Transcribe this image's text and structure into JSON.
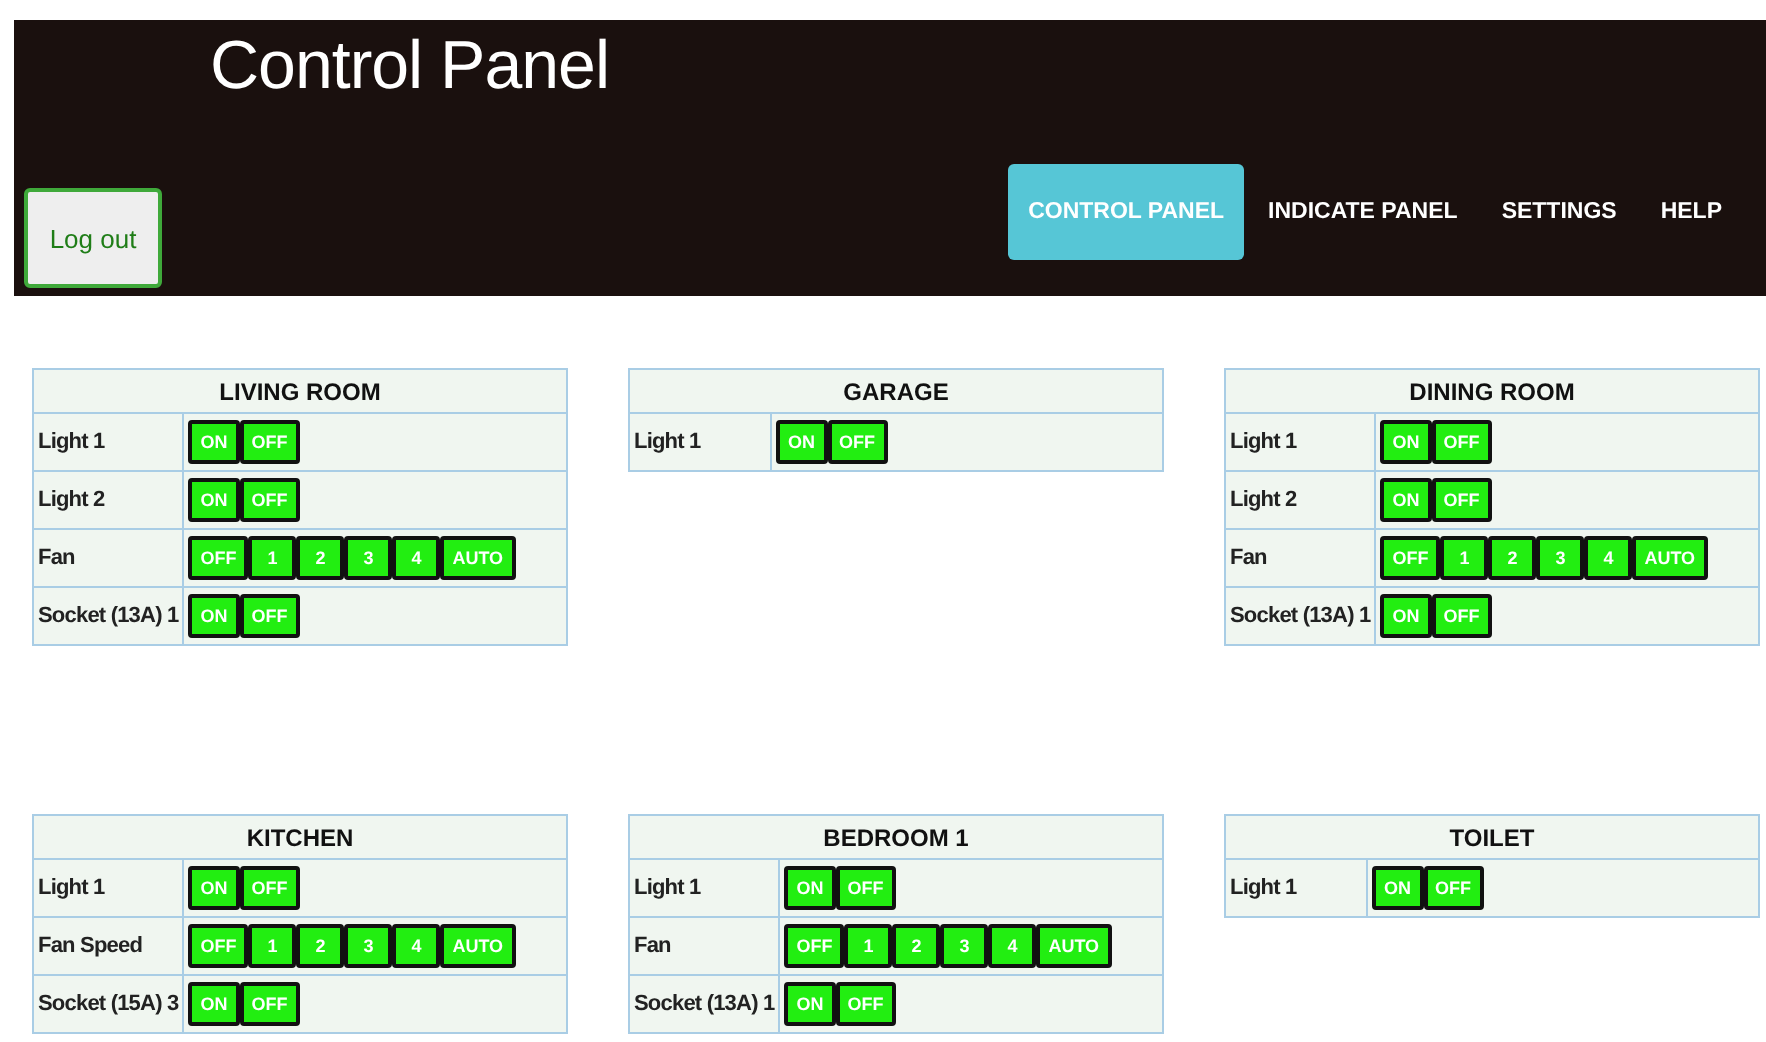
{
  "header": {
    "title": "Control Panel",
    "logout": "Log out",
    "nav": [
      {
        "label": "CONTROL PANEL",
        "selected": true
      },
      {
        "label": "INDICATE PANEL",
        "selected": false
      },
      {
        "label": "SETTINGS",
        "selected": false
      },
      {
        "label": "HELP",
        "selected": false
      }
    ]
  },
  "rooms": [
    {
      "name": "LIVING ROOM",
      "rows": [
        {
          "label": "Light 1",
          "buttons": [
            "ON",
            "OFF"
          ]
        },
        {
          "label": "Light 2",
          "buttons": [
            "ON",
            "OFF"
          ]
        },
        {
          "label": "Fan",
          "buttons": [
            "OFF",
            "1",
            "2",
            "3",
            "4",
            "AUTO"
          ]
        },
        {
          "label": "Socket (13A) 1",
          "buttons": [
            "ON",
            "OFF"
          ]
        }
      ]
    },
    {
      "name": "GARAGE",
      "rows": [
        {
          "label": "Light 1",
          "buttons": [
            "ON",
            "OFF"
          ]
        }
      ]
    },
    {
      "name": "DINING ROOM",
      "rows": [
        {
          "label": "Light 1",
          "buttons": [
            "ON",
            "OFF"
          ]
        },
        {
          "label": "Light 2",
          "buttons": [
            "ON",
            "OFF"
          ]
        },
        {
          "label": "Fan",
          "buttons": [
            "OFF",
            "1",
            "2",
            "3",
            "4",
            "AUTO"
          ]
        },
        {
          "label": "Socket (13A) 1",
          "buttons": [
            "ON",
            "OFF"
          ]
        }
      ]
    },
    {
      "name": "KITCHEN",
      "rows": [
        {
          "label": "Light 1",
          "buttons": [
            "ON",
            "OFF"
          ]
        },
        {
          "label": "Fan Speed",
          "buttons": [
            "OFF",
            "1",
            "2",
            "3",
            "4",
            "AUTO"
          ]
        },
        {
          "label": "Socket (15A) 3",
          "buttons": [
            "ON",
            "OFF"
          ]
        }
      ]
    },
    {
      "name": "BEDROOM 1",
      "rows": [
        {
          "label": "Light 1",
          "buttons": [
            "ON",
            "OFF"
          ]
        },
        {
          "label": "Fan",
          "buttons": [
            "OFF",
            "1",
            "2",
            "3",
            "4",
            "AUTO"
          ]
        },
        {
          "label": "Socket (13A) 1",
          "buttons": [
            "ON",
            "OFF"
          ]
        }
      ]
    },
    {
      "name": "TOILET",
      "rows": [
        {
          "label": "Light 1",
          "buttons": [
            "ON",
            "OFF"
          ]
        }
      ]
    }
  ]
}
